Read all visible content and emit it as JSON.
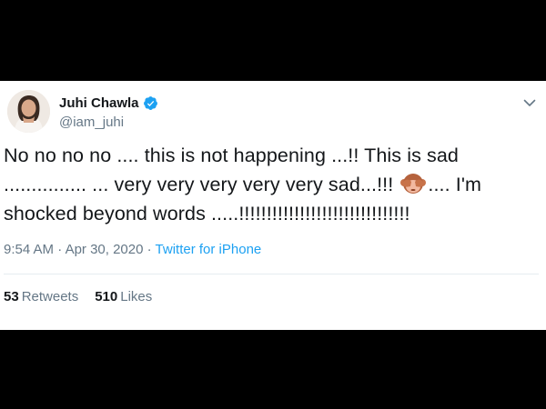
{
  "user": {
    "name": "Juhi Chawla",
    "handle": "@iam_juhi",
    "verified": true
  },
  "tweet": {
    "line1": "No no no no .... this is not happening ...!! This is sad",
    "line2_before_emoji": "............... ... very very very very very sad...!!! ",
    "emoji": "see-no-evil-monkey",
    "line2_after_emoji": ".... I'm",
    "line3": "shocked beyond words .....!!!!!!!!!!!!!!!!!!!!!!!!!!!!!!!"
  },
  "meta": {
    "time": "9:54 AM",
    "separator": "·",
    "date": "Apr 30, 2020",
    "source": "Twitter for iPhone"
  },
  "stats": {
    "retweets_count": "53",
    "retweets_label": "Retweets",
    "likes_count": "510",
    "likes_label": "Likes"
  },
  "colors": {
    "verified_blue": "#1da1f2",
    "link_blue": "#1da1f2",
    "muted_gray": "#657786",
    "text": "#14171a"
  }
}
